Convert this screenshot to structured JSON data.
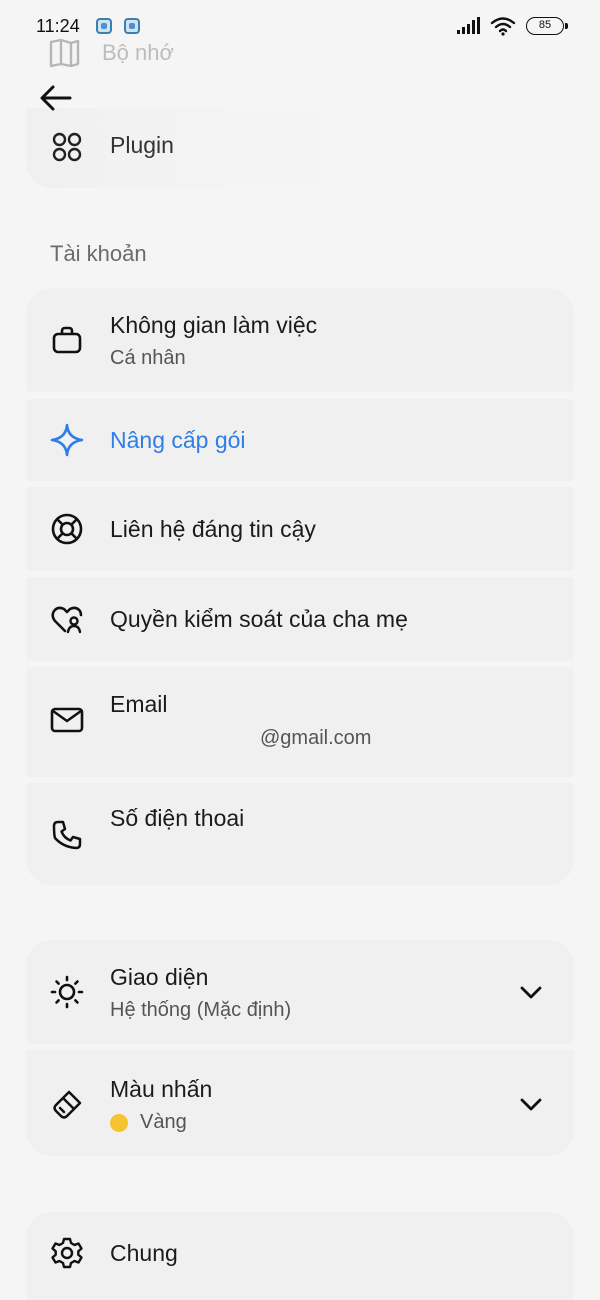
{
  "status_bar": {
    "time": "11:24",
    "battery": "85"
  },
  "top_faded": {
    "label": "Bộ nhớ"
  },
  "plugin": {
    "label": "Plugin"
  },
  "account_section": {
    "label": "Tài khoản"
  },
  "items": {
    "workspace": {
      "title": "Không gian làm việc",
      "subtitle": "Cá nhân"
    },
    "upgrade": {
      "title": "Nâng cấp gói"
    },
    "trusted_contact": {
      "title": "Liên hệ đáng tin cậy"
    },
    "parental": {
      "title": "Quyền kiểm soát của cha mẹ"
    },
    "email": {
      "title": "Email",
      "value": "@gmail.com"
    },
    "phone": {
      "title": "Số điện thoai"
    },
    "appearance": {
      "title": "Giao diện",
      "subtitle": "Hệ thống (Mặc định)"
    },
    "accent": {
      "title": "Màu nhấn",
      "subtitle": "Vàng"
    },
    "general": {
      "title": "Chung"
    }
  },
  "colors": {
    "accent_blue": "#2f7ee6",
    "accent_yellow": "#f7c331"
  }
}
